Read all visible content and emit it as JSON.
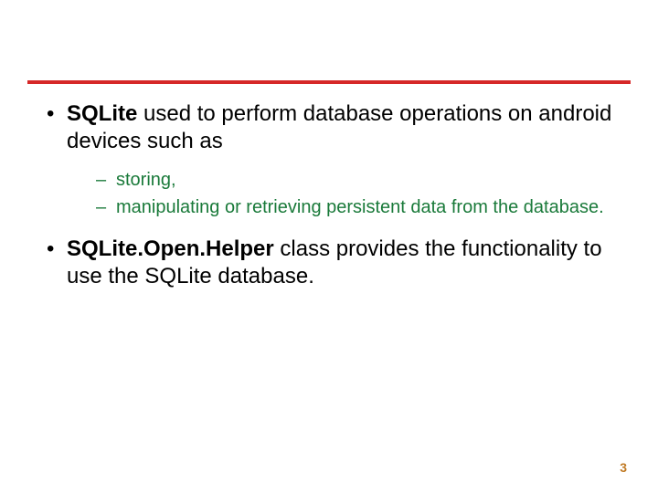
{
  "bullets": [
    {
      "bold": "SQLite",
      "rest": " used to perform database operations on android devices such as",
      "sub": [
        "storing,",
        "manipulating or retrieving persistent data from the database."
      ]
    },
    {
      "bold": "SQLite.Open.Helper",
      "rest": " class provides the functionality to use the SQLite database.",
      "sub": []
    }
  ],
  "page_number": "3"
}
